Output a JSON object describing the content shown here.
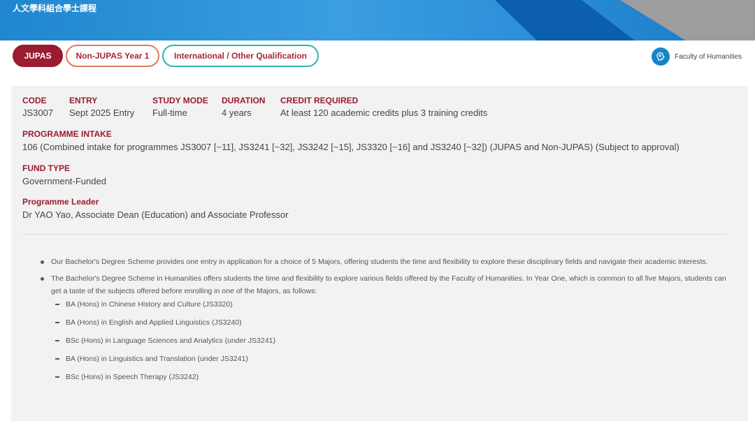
{
  "header": {
    "title": "人文學科組合學士課程"
  },
  "tabs": [
    {
      "label": "JUPAS"
    },
    {
      "label": "Non-JUPAS Year 1"
    },
    {
      "label": "International / Other Qualification"
    }
  ],
  "faculty": {
    "name": "Faculty of Humanities",
    "icon": "head-brain-icon"
  },
  "info": {
    "code_label": "CODE",
    "code": "JS3007",
    "entry_label": "ENTRY",
    "entry": "Sept 2025 Entry",
    "mode_label": "STUDY MODE",
    "mode": "Full-time",
    "duration_label": "DURATION",
    "duration": "4 years",
    "credit_label": "CREDIT REQUIRED",
    "credit": "At least 120 academic credits plus 3 training credits",
    "intake_label": "PROGRAMME INTAKE",
    "intake": "106 (Combined intake for programmes JS3007 [~11], JS3241 [~32], JS3242 [~15], JS3320 [~16] and JS3240 [~32]) (JUPAS and Non-JUPAS) (Subject to approval)",
    "fund_label": "FUND TYPE",
    "fund": "Government-Funded",
    "leader_label": "Programme Leader",
    "leader": "Dr YAO Yao, Associate Dean (Education) and Associate Professor"
  },
  "description": {
    "bullets": [
      "Our Bachelor's Degree Scheme provides one entry in application for a choice of 5 Majors, offering students the time and flexibility to explore these disciplinary fields and navigate their academic interests.",
      "The Bachelor's Degree Scheme in Humanities offers students the time and flexibility to explore various fields offered by the Faculty of Humanities. In Year One, which is common to all five Majors, students can get a taste of the subjects offered before enrolling in one of the Majors, as follows:"
    ],
    "majors": [
      "BA (Hons) in Chinese History and Culture (JS3320)",
      "BA (Hons) in English and Applied Linguistics (JS3240)",
      "BSc (Hons) in Language Sciences and Analytics (under JS3241)",
      "BA (Hons) in Linguistics and Translation (under JS3241)",
      "BSc (Hons) in Speech Therapy (JS3242)"
    ]
  },
  "colors": {
    "accent": "#9b1b30",
    "banner": "#2d8fd8",
    "teal": "#2bb6b0",
    "coral": "#e07a5f"
  }
}
